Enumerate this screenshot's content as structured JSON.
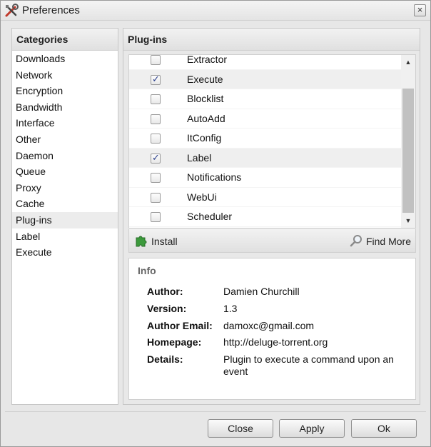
{
  "window": {
    "title": "Preferences",
    "close_glyph": "×",
    "title_icon": "wrench-screwdriver-icon"
  },
  "categories": {
    "header": "Categories",
    "items": [
      {
        "label": "Downloads",
        "selected": false
      },
      {
        "label": "Network",
        "selected": false
      },
      {
        "label": "Encryption",
        "selected": false
      },
      {
        "label": "Bandwidth",
        "selected": false
      },
      {
        "label": "Interface",
        "selected": false
      },
      {
        "label": "Other",
        "selected": false
      },
      {
        "label": "Daemon",
        "selected": false
      },
      {
        "label": "Queue",
        "selected": false
      },
      {
        "label": "Proxy",
        "selected": false
      },
      {
        "label": "Cache",
        "selected": false
      },
      {
        "label": "Plug-ins",
        "selected": true
      },
      {
        "label": "Label",
        "selected": false
      },
      {
        "label": "Execute",
        "selected": false
      }
    ]
  },
  "plugins": {
    "header": "Plug-ins",
    "list": [
      {
        "name": "Extractor",
        "enabled": false,
        "highlighted": false
      },
      {
        "name": "Execute",
        "enabled": true,
        "highlighted": true
      },
      {
        "name": "Blocklist",
        "enabled": false,
        "highlighted": false
      },
      {
        "name": "AutoAdd",
        "enabled": false,
        "highlighted": false
      },
      {
        "name": "ItConfig",
        "enabled": false,
        "highlighted": false
      },
      {
        "name": "Label",
        "enabled": true,
        "highlighted": true
      },
      {
        "name": "Notifications",
        "enabled": false,
        "highlighted": false
      },
      {
        "name": "WebUi",
        "enabled": false,
        "highlighted": false
      },
      {
        "name": "Scheduler",
        "enabled": false,
        "highlighted": false
      }
    ],
    "toolbar": {
      "install_label": "Install",
      "install_icon": "puzzle-piece-icon",
      "find_more_label": "Find More",
      "find_more_icon": "magnifier-icon"
    }
  },
  "info": {
    "legend": "Info",
    "author_label": "Author:",
    "author_value": "Damien Churchill",
    "version_label": "Version:",
    "version_value": "1.3",
    "email_label": "Author Email:",
    "email_value": "damoxc@gmail.com",
    "homepage_label": "Homepage:",
    "homepage_value": "http://deluge-torrent.org",
    "details_label": "Details:",
    "details_value": "Plugin to execute a command upon an event"
  },
  "buttons": {
    "close": "Close",
    "apply": "Apply",
    "ok": "Ok"
  },
  "colors": {
    "install_icon_green": "#3c9a3c",
    "checkmark": "#2b3f8c",
    "selection_bg": "#ececec"
  }
}
